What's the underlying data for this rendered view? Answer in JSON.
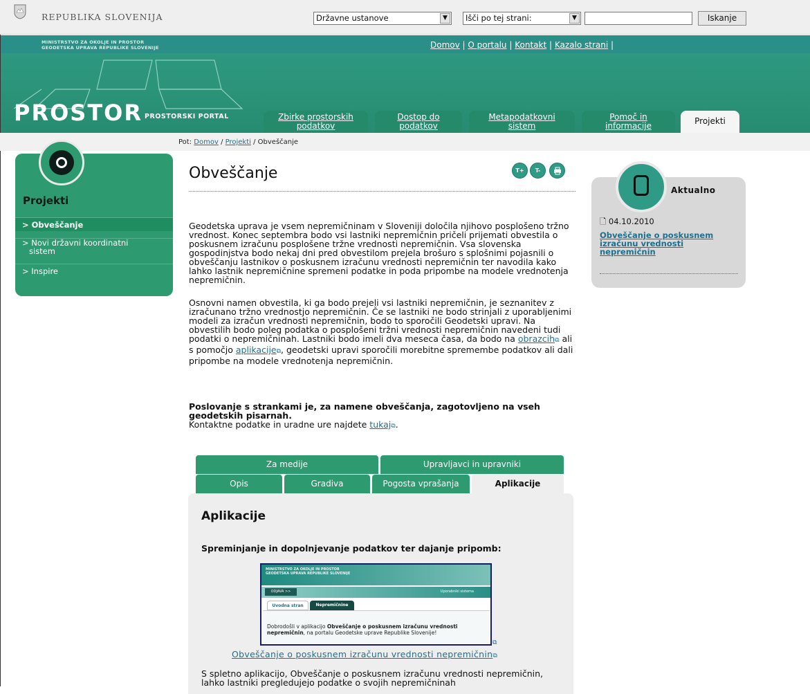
{
  "topbar": {
    "country": "REPUBLIKA SLOVENIJA",
    "institutions_select": "Državne ustanove",
    "scope_select": "Išči po tej strani:",
    "search_value": "",
    "search_button": "Iskanje"
  },
  "header": {
    "ministry_line1": "MINISTRSTVO ZA OKOLJE IN PROSTOR",
    "ministry_line2": "GEODETSKA UPRAVA REPUBLIKE SLOVENIJE",
    "links": [
      "Domov",
      "O portalu",
      "Kontakt",
      "Kazalo strani"
    ],
    "logo": "PROSTOR",
    "logo_sub": "PROSTORSKI PORTAL",
    "tabs": [
      {
        "l1": "Zbirke prostorskih",
        "l2": "podatkov"
      },
      {
        "l1": "Dostop do",
        "l2": "podatkov"
      },
      {
        "l1": "Metapodatkovni",
        "l2": "sistem"
      },
      {
        "l1": "Pomoč in",
        "l2": "informacije"
      },
      {
        "l1": "Projekti",
        "l2": ""
      }
    ]
  },
  "breadcrumb": {
    "prefix": "Pot:",
    "home": "Domov",
    "section": "Projekti",
    "current": "/ Obveščanje"
  },
  "sidebar": {
    "title": "Projekti",
    "items": [
      {
        "label": "> Obveščanje"
      },
      {
        "label": "> Novi državni koordinatni"
      },
      {
        "label": "sistem"
      },
      {
        "label": "> Inspire"
      }
    ]
  },
  "main": {
    "title": "Obveščanje",
    "tool_icons": [
      "T+",
      "T-",
      "print-icon"
    ],
    "p1": "Geodetska uprava je vsem nepremičninam v Sloveniji določila njihovo posplošeno tržno vrednost. Konec septembra bodo vsi lastniki nepremičnin pričeli prijemati obvestila o poskusnem izračunu posplošene tržne vrednosti nepremičnin.  Vsa slovenska gospodinjstva bodo nekaj dni pred obvestilom prejela brošuro s splošnimi pojasnili o obveščanju lastnikov o poskusnem izračunu vrednosti nepremičnin ter navodila kako lahko lastnik nepremičnine spremeni podatke in poda pripombe na modele vrednotenja nepremičnin.",
    "p2a": "Osnovni namen obvestila, ki ga bodo prejeli vsi lastniki nepremičnin, je seznanitev z izračunano tržno vrednostjo nepremičnin. Če se lastniki ne bodo strinjali z uporabljenimi modeli za izračun vrednosti nepremičnin, bodo to sporočili Geodetski upravi. Na obvestilih bodo poleg podatka o posplošeni tržni vrednosti nepremičnin navedeni tudi podatki o nepremičninah. Lastniki bodo imeli dva meseca časa, da bodo na",
    "p2_link1": "obrazcih",
    "p2b": " ali s pomočjo",
    "p2_link2": "aplikacije",
    "p2c": ", geodetski upravi sporočili morebitne spremembe podatkov ali dali pripombe na modele vrednotenja nepremičnin.",
    "p3_bold": "Poslovanje s strankami je, za namene obveščanja, zagotovljeno na vseh geodetskih pisarnah.",
    "p3_text": "Kontaktne podatke in uradne ure najdete",
    "p3_link": "tukaj"
  },
  "aside": {
    "title": "Aktualno",
    "date": "04.10.2010",
    "link": "Obveščanje o poskusnem izračunu vrednosti nepremičnin"
  },
  "subtabs": {
    "row1": [
      "Za medije",
      "Upravljavci in upravniki"
    ],
    "row2": [
      "Opis",
      "Gradiva",
      "Pogosta vprašanja",
      "Aplikacije"
    ]
  },
  "panel": {
    "title": "Aplikacije",
    "subtitle": "Spreminjanje in dopolnjevanje podatkov ter dajanje pripomb:",
    "thumb": {
      "line1": "MINISTRSTVO ZA OKOLJE IN PROSTOR",
      "line2": "GEODETSKA UPRAVA REPUBLIKE SLOVENIJE",
      "odjava": "ODJAVA >>",
      "right": "Uporabniki sistema",
      "tab1": "Uvodna stran",
      "tab2": "Nepremičnine",
      "msg_a": "Dobrodošli v aplikacijo ",
      "msg_b": "Obveščanje o poskusnem izračunu vrednosti nepremičnin",
      "msg_c": ", na portalu Geodetske uprave Republike Slovenije!"
    },
    "link": "Obveščanje o poskusnem izračunu vrednosti nepremičnin",
    "bottom": "S spletno aplikacijo, Obveščanje o poskusnem izračunu vrednosti nepremičnin, lahko lastniki pregledujejo podatke o svojih nepremičninah"
  },
  "colors": {
    "green": "#2e9a6f",
    "teal": "#2f9a86",
    "link": "#1f6f8c",
    "panel_gray": "#eeeeee"
  }
}
